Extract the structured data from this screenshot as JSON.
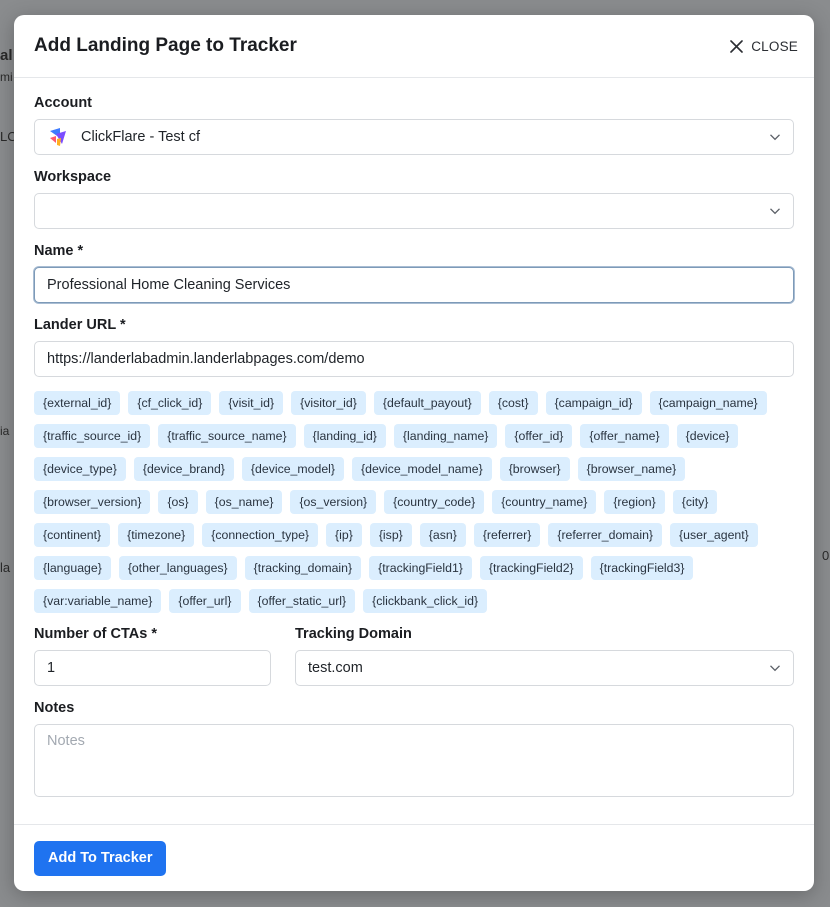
{
  "background": {
    "fragments": [
      "al",
      "mi",
      "LC",
      "ia",
      "la",
      "0"
    ]
  },
  "modal": {
    "title": "Add Landing Page to Tracker",
    "close_label": "CLOSE"
  },
  "form": {
    "account": {
      "label": "Account",
      "value": "ClickFlare - Test cf"
    },
    "workspace": {
      "label": "Workspace",
      "value": ""
    },
    "name": {
      "label": "Name *",
      "value": "Professional Home Cleaning Services"
    },
    "lander_url": {
      "label": "Lander URL *",
      "value": "https://landerlabadmin.landerlabpages.com/demo"
    },
    "tokens": [
      "{external_id}",
      "{cf_click_id}",
      "{visit_id}",
      "{visitor_id}",
      "{default_payout}",
      "{cost}",
      "{campaign_id}",
      "{campaign_name}",
      "{traffic_source_id}",
      "{traffic_source_name}",
      "{landing_id}",
      "{landing_name}",
      "{offer_id}",
      "{offer_name}",
      "{device}",
      "{device_type}",
      "{device_brand}",
      "{device_model}",
      "{device_model_name}",
      "{browser}",
      "{browser_name}",
      "{browser_version}",
      "{os}",
      "{os_name}",
      "{os_version}",
      "{country_code}",
      "{country_name}",
      "{region}",
      "{city}",
      "{continent}",
      "{timezone}",
      "{connection_type}",
      "{ip}",
      "{isp}",
      "{asn}",
      "{referrer}",
      "{referrer_domain}",
      "{user_agent}",
      "{language}",
      "{other_languages}",
      "{tracking_domain}",
      "{trackingField1}",
      "{trackingField2}",
      "{trackingField3}",
      "{var:variable_name}",
      "{offer_url}",
      "{offer_static_url}",
      "{clickbank_click_id}"
    ],
    "ctas": {
      "label": "Number of CTAs *",
      "value": "1"
    },
    "tracking_domain": {
      "label": "Tracking Domain",
      "value": "test.com"
    },
    "notes": {
      "label": "Notes",
      "placeholder": "Notes"
    }
  },
  "footer": {
    "submit_label": "Add To Tracker"
  },
  "colors": {
    "primary": "#1f73f0",
    "tag_bg": "#dbeefe",
    "overlay": "#8d8d8d"
  }
}
